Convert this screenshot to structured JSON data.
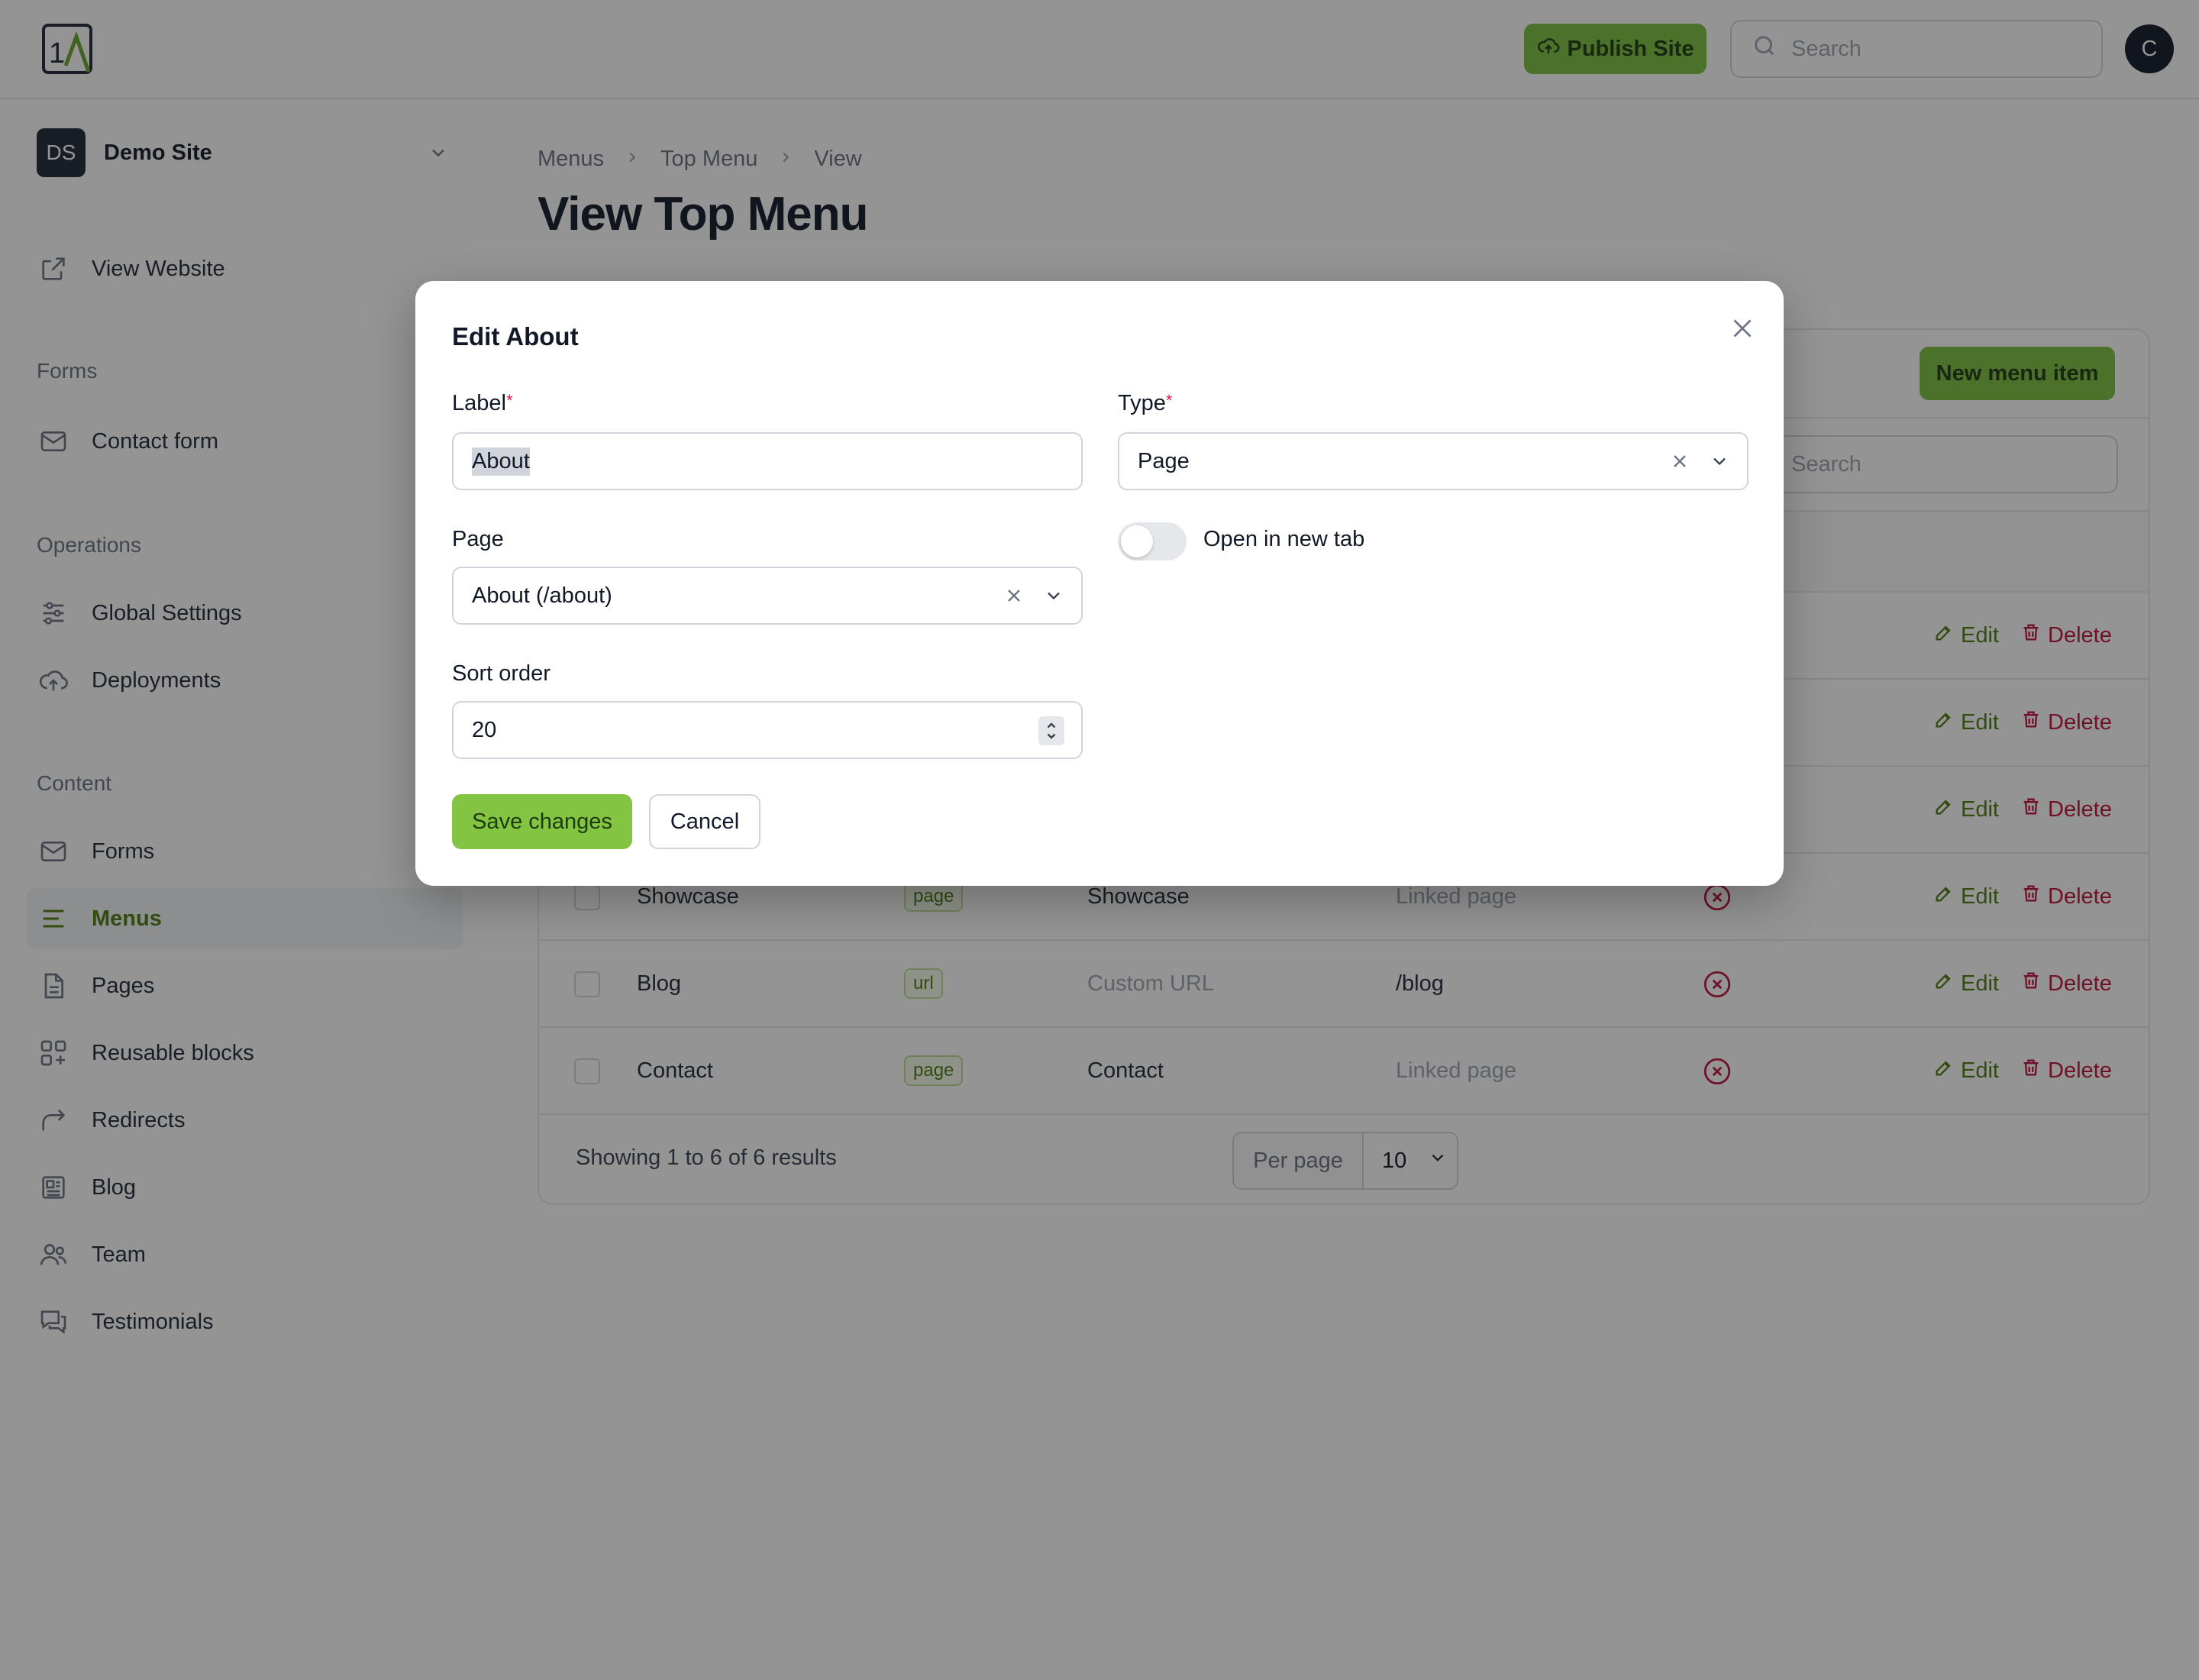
{
  "app": {
    "publish_label": "Publish Site",
    "search_placeholder": "Search",
    "avatar_initial": "C",
    "accent_color": "#7bbf3f"
  },
  "sidebar": {
    "site_badge": "DS",
    "site_name": "Demo Site",
    "view_website": "View Website",
    "groups": {
      "forms": "Forms",
      "operations": "Operations",
      "content": "Content"
    },
    "items": {
      "contact_form": "Contact form",
      "global_settings": "Global Settings",
      "deployments": "Deployments",
      "forms": "Forms",
      "menus": "Menus",
      "pages": "Pages",
      "reusable_blocks": "Reusable blocks",
      "redirects": "Redirects",
      "blog": "Blog",
      "team": "Team",
      "testimonials": "Testimonials"
    }
  },
  "breadcrumb": [
    "Menus",
    "Top Menu",
    "View"
  ],
  "page_title": "View Top Menu",
  "table": {
    "new_item_label": "New menu item",
    "search_placeholder": "Search",
    "rows": [
      {
        "label": "",
        "badge": "",
        "target": "",
        "url": "",
        "edit": "Edit",
        "delete": "Delete"
      },
      {
        "label": "",
        "badge": "",
        "target": "",
        "url": "",
        "edit": "Edit",
        "delete": "Delete"
      },
      {
        "label": "",
        "badge": "",
        "target": "",
        "url": "",
        "edit": "Edit",
        "delete": "Delete"
      },
      {
        "label": "Showcase",
        "badge": "page",
        "target": "Showcase",
        "url": "Linked page",
        "edit": "Edit",
        "delete": "Delete"
      },
      {
        "label": "Blog",
        "badge": "url",
        "target": "Custom URL",
        "url": "/blog",
        "edit": "Edit",
        "delete": "Delete"
      },
      {
        "label": "Contact",
        "badge": "page",
        "target": "Contact",
        "url": "Linked page",
        "edit": "Edit",
        "delete": "Delete"
      }
    ],
    "results_text": "Showing 1 to 6 of 6 results",
    "per_page_label": "Per page",
    "per_page_value": "10"
  },
  "modal": {
    "title": "Edit About",
    "label_field": {
      "label": "Label",
      "value": "About"
    },
    "type_field": {
      "label": "Type",
      "value": "Page"
    },
    "page_field": {
      "label": "Page",
      "value": "About (/about)"
    },
    "sort_field": {
      "label": "Sort order",
      "value": "20"
    },
    "toggle_label": "Open in new tab",
    "toggle_on": false,
    "required_mark": "*",
    "save_label": "Save changes",
    "cancel_label": "Cancel"
  }
}
